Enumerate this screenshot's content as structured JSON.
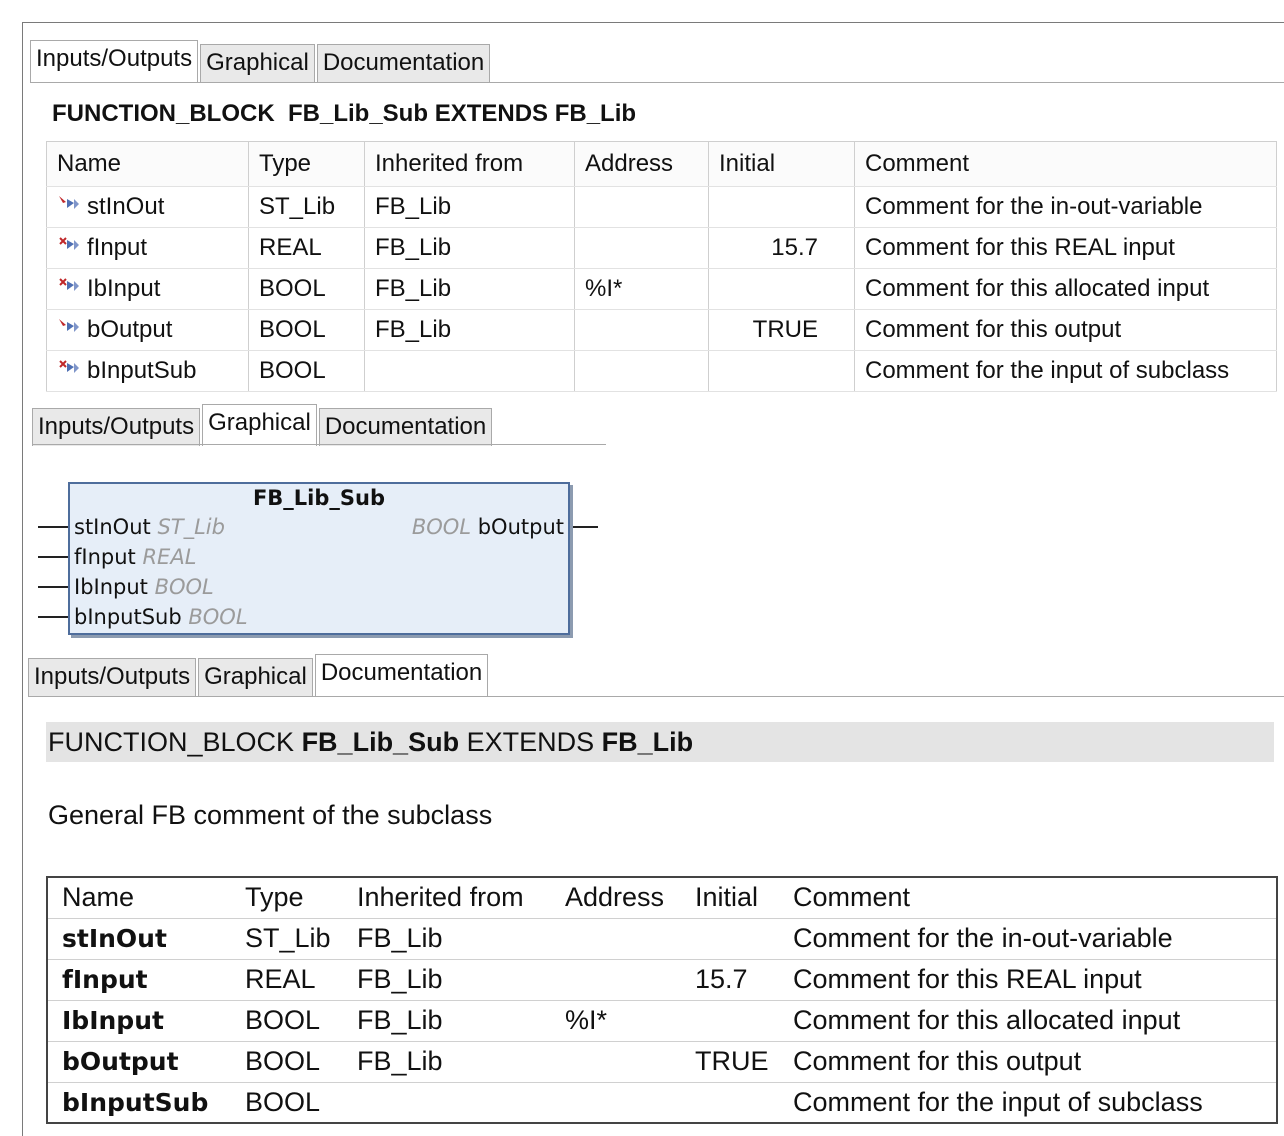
{
  "tabs": [
    "Inputs/Outputs",
    "Graphical",
    "Documentation"
  ],
  "declaration": {
    "keyword": "FUNCTION_BLOCK",
    "name": "FB_Lib_Sub",
    "extends_keyword": "EXTENDS",
    "base": "FB_Lib"
  },
  "grid": {
    "columns": [
      "Name",
      "Type",
      "Inherited from",
      "Address",
      "Initial",
      "Comment"
    ],
    "rows": [
      {
        "name": "stInOut",
        "type": "ST_Lib",
        "inherited": "FB_Lib",
        "address": "",
        "initial": "",
        "comment": "Comment for the in-out-variable",
        "icon": "inout-variable-icon"
      },
      {
        "name": "fInput",
        "type": "REAL",
        "inherited": "FB_Lib",
        "address": "",
        "initial": "15.7",
        "comment": "Comment for this REAL input",
        "icon": "input-variable-icon"
      },
      {
        "name": "IbInput",
        "type": "BOOL",
        "inherited": "FB_Lib",
        "address": "%I*",
        "initial": "",
        "comment": "Comment for this allocated input",
        "icon": "input-variable-icon"
      },
      {
        "name": "bOutput",
        "type": "BOOL",
        "inherited": "FB_Lib",
        "address": "",
        "initial": "TRUE",
        "comment": "Comment for this output",
        "icon": "output-variable-icon"
      },
      {
        "name": "bInputSub",
        "type": "BOOL",
        "inherited": "",
        "address": "",
        "initial": "",
        "comment": "Comment for the input of subclass",
        "icon": "input-variable-icon"
      }
    ]
  },
  "graphical": {
    "block_name": "FB_Lib_Sub",
    "inputs": [
      {
        "name": "stInOut",
        "type": "ST_Lib"
      },
      {
        "name": "fInput",
        "type": "REAL"
      },
      {
        "name": "IbInput",
        "type": "BOOL"
      },
      {
        "name": "bInputSub",
        "type": "BOOL"
      }
    ],
    "outputs": [
      {
        "name": "bOutput",
        "type": "BOOL"
      }
    ]
  },
  "documentation": {
    "general_comment": "General FB comment of the subclass"
  },
  "colors": {
    "block_fill": "#e6eef8",
    "block_border": "#4e6d9c",
    "doc_header_bg": "#e4e4e4",
    "type_hint": "#9b9b9b"
  }
}
